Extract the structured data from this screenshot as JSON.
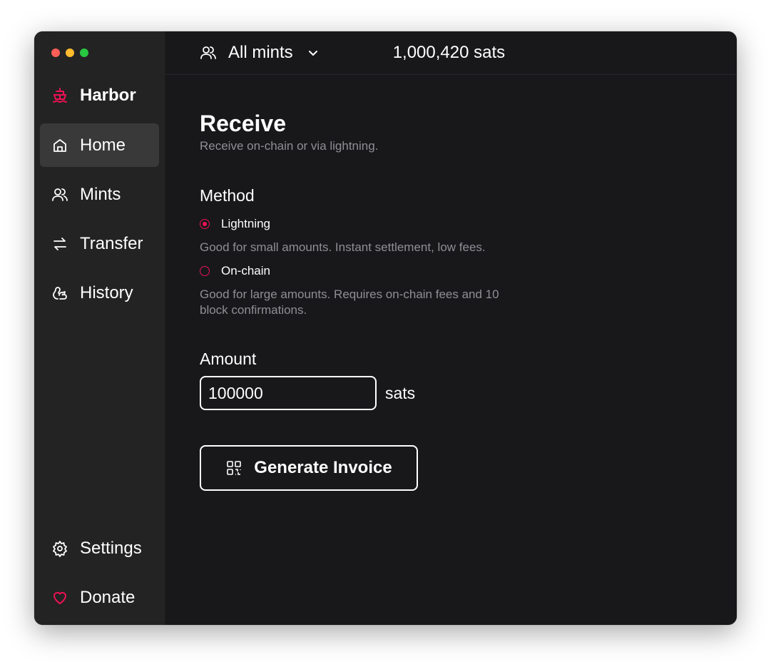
{
  "app": {
    "name": "Harbor",
    "accent": "#ee1155"
  },
  "sidebar": {
    "items": [
      {
        "label": "Home",
        "icon": "home-icon",
        "active": true
      },
      {
        "label": "Mints",
        "icon": "users-icon",
        "active": false
      },
      {
        "label": "Transfer",
        "icon": "arrows-left-right-icon",
        "active": false
      },
      {
        "label": "History",
        "icon": "squirrel-icon",
        "active": false
      }
    ],
    "bottom_items": [
      {
        "label": "Settings",
        "icon": "gear-icon"
      },
      {
        "label": "Donate",
        "icon": "heart-icon"
      }
    ]
  },
  "topbar": {
    "mint_selector": "All mints",
    "balance": "1,000,420 sats"
  },
  "page": {
    "title": "Receive",
    "subtitle": "Receive on-chain or via lightning.",
    "method_label": "Method",
    "methods": [
      {
        "label": "Lightning",
        "help": "Good for small amounts. Instant settlement, low fees.",
        "selected": true
      },
      {
        "label": "On-chain",
        "help": "Good for large amounts. Requires on-chain fees and 10 block confirmations.",
        "selected": false
      }
    ],
    "amount_label": "Amount",
    "amount_value": "100000",
    "amount_unit": "sats",
    "generate_button": "Generate Invoice"
  }
}
